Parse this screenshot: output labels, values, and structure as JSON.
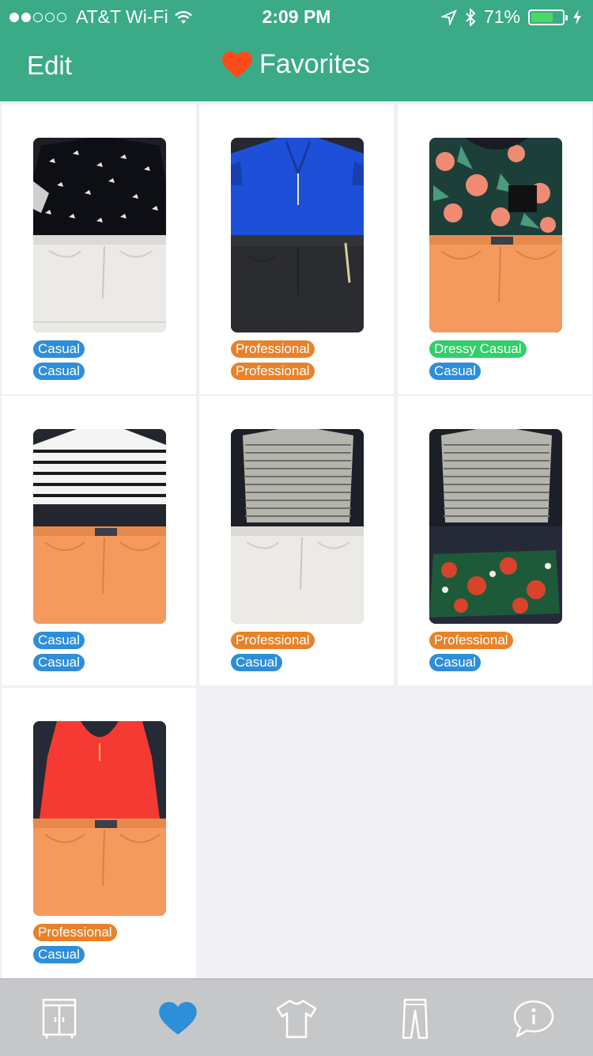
{
  "status_bar": {
    "carrier": "AT&T Wi-Fi",
    "time": "2:09 PM",
    "battery": "71%",
    "battery_level": 0.71
  },
  "nav": {
    "edit_label": "Edit",
    "title": "Favorites",
    "title_icon": "heart-icon"
  },
  "colors": {
    "header": "#3aaa87",
    "tag_casual": "#2d8ed9",
    "tag_professional": "#e8822a",
    "tag_dressy_casual": "#2fcf6b",
    "tab_active": "#2d8ed9"
  },
  "outfits": [
    {
      "top_tag": "Casual",
      "bottom_tag": "Casual"
    },
    {
      "top_tag": "Professional",
      "bottom_tag": "Professional"
    },
    {
      "top_tag": "Dressy Casual",
      "bottom_tag": "Casual"
    },
    {
      "top_tag": "Casual",
      "bottom_tag": "Casual"
    },
    {
      "top_tag": "Professional",
      "bottom_tag": "Casual"
    },
    {
      "top_tag": "Professional",
      "bottom_tag": "Casual"
    },
    {
      "top_tag": "Professional",
      "bottom_tag": "Casual"
    }
  ],
  "tabs": [
    {
      "icon": "wardrobe-icon",
      "active": false
    },
    {
      "icon": "heart-icon",
      "active": true
    },
    {
      "icon": "shirt-icon",
      "active": false
    },
    {
      "icon": "pants-icon",
      "active": false
    },
    {
      "icon": "info-bubble-icon",
      "active": false
    }
  ]
}
